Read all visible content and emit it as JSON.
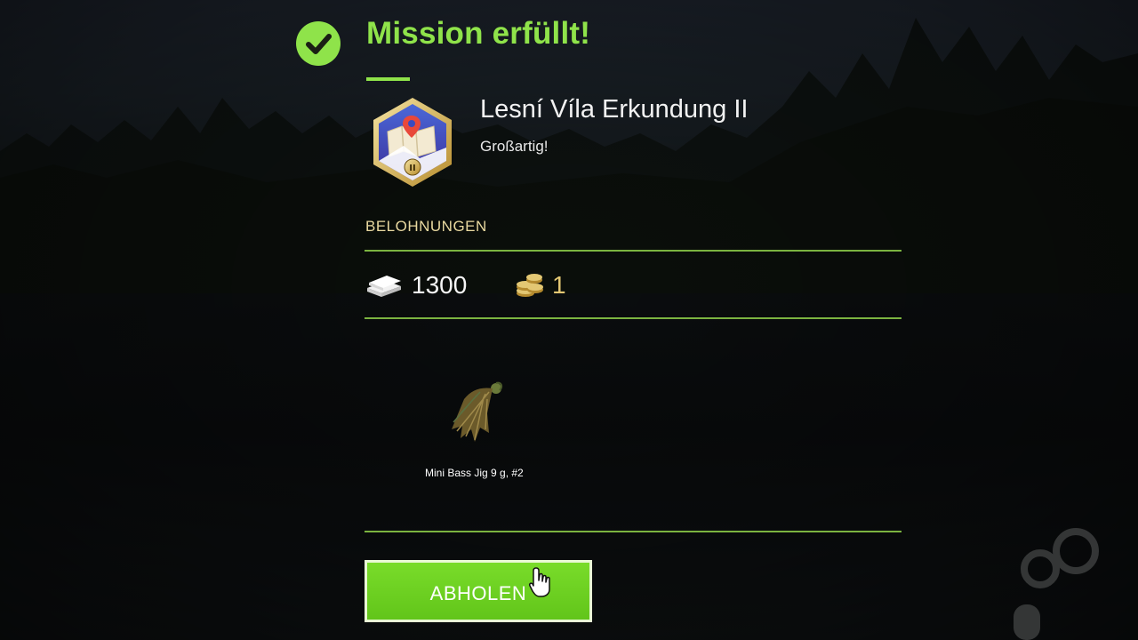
{
  "header": {
    "title": "Mission erfüllt!",
    "check_icon": "check-circle-icon",
    "accent_color": "#8fe34a"
  },
  "mission": {
    "badge_icon": "map-pin-hexagon-badge-icon",
    "badge_level": "II",
    "name": "Lesní Víla Erkundung II",
    "subtitle": "Großartig!"
  },
  "rewards": {
    "label": "BELOHNUNGEN",
    "currency": [
      {
        "icon": "banknotes-icon",
        "value": "1300"
      },
      {
        "icon": "coins-icon",
        "value": "1"
      }
    ],
    "items": [
      {
        "icon": "bass-jig-lure-icon",
        "label": "Mini Bass Jig 9 g, #2"
      }
    ]
  },
  "actions": {
    "claim_label": "ABHOLEN",
    "cursor_icon": "hand-pointer-icon"
  }
}
